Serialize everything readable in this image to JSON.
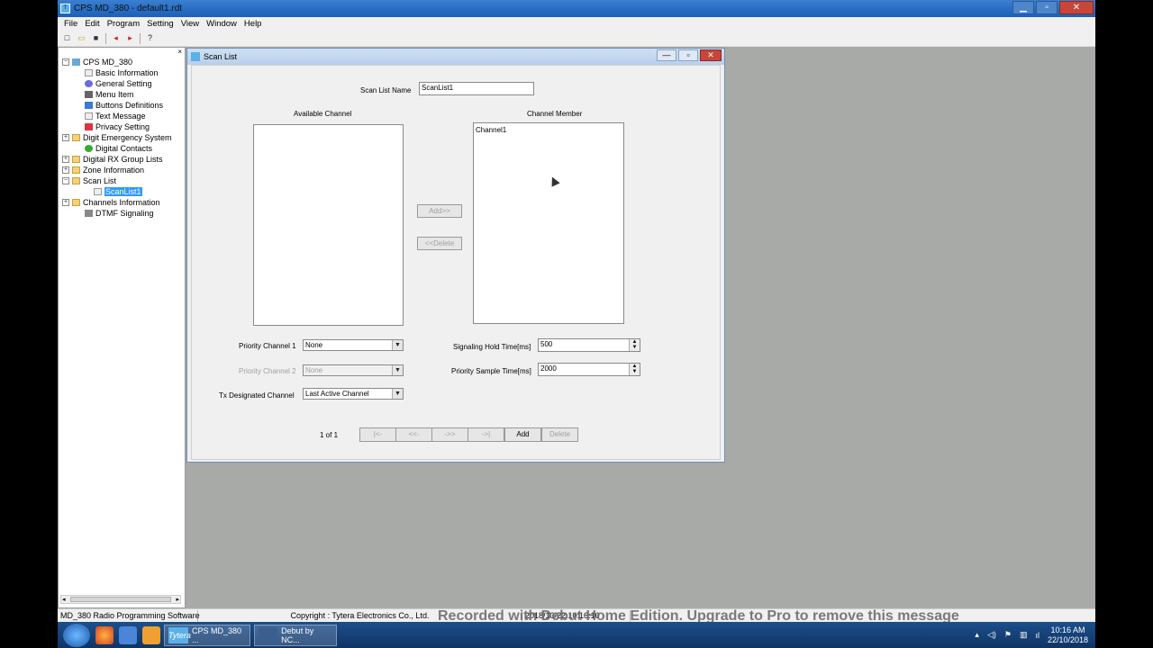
{
  "window": {
    "title": "CPS MD_380 - default1.rdt",
    "icon_text": "T"
  },
  "menu": [
    "File",
    "Edit",
    "Program",
    "Setting",
    "View",
    "Window",
    "Help"
  ],
  "toolbar_icons": [
    "new-icon",
    "open-icon",
    "save-icon",
    "read-icon",
    "write-icon",
    "help-icon"
  ],
  "toolbar_glyphs": {
    "new": "□",
    "open": "▭",
    "save": "■",
    "read": "◂",
    "write": "▸",
    "help": "?"
  },
  "tree": {
    "root": "CPS MD_380",
    "items": [
      "Basic Information",
      "General Setting",
      "Menu Item",
      "Buttons Definitions",
      "Text Message",
      "Privacy Setting",
      "Digit Emergency System",
      "Digital Contacts",
      "Digital RX Group Lists",
      "Zone Information",
      "Scan List",
      "ScanList1",
      "Channels Information",
      "DTMF Signaling"
    ],
    "close_glyph": "×",
    "expand_glyph": "+",
    "collapse_glyph": "−",
    "scroll_left": "◂",
    "scroll_right": "▸"
  },
  "scanlist_window": {
    "title": "Scan List",
    "minimize": "—",
    "maximize": "▫",
    "close": "✕",
    "name_label": "Scan List Name",
    "name_value": "ScanList1",
    "available_label": "Available Channel",
    "member_label": "Channel Member",
    "members": [
      "Channel1"
    ],
    "add_button": "Add>>",
    "delete_button": "<<Delete",
    "priority1_label": "Priority Channel 1",
    "priority1_value": "None",
    "priority2_label": "Priority Channel 2",
    "priority2_value": "None",
    "tx_label": "Tx Designated Channel",
    "tx_value": "Last Active Channel",
    "hold_label": "Signaling Hold Time[ms]",
    "hold_value": "500",
    "sample_label": "Priority Sample Time[ms]",
    "sample_value": "2000",
    "dropdown_glyph": "▼",
    "spin_up": "▲",
    "spin_down": "▼",
    "pager": {
      "count": "1 of 1",
      "first": "|<-",
      "prev": "<<-",
      "next": "->>",
      "last": "->|",
      "add": "Add",
      "delete": "Delete"
    }
  },
  "statusbar": {
    "app": "MD_380 Radio Programming Software",
    "copyright": "Copyright : Tytera Electronics Co., Ltd.",
    "datetime": "2018/10/22 10:16:10"
  },
  "watermark": "Recorded with Debut Home Edition. Upgrade to Pro to remove this message",
  "taskbar": {
    "tasks": [
      {
        "icon": "Tytera",
        "label": "CPS MD_380 ..."
      },
      {
        "icon": "",
        "label": "Debut by NC..."
      }
    ],
    "time": "10:16 AM",
    "date": "22/10/2018",
    "tray_glyphs": {
      "up": "▴",
      "sound": "◁)",
      "flag": "⚑",
      "network": "▥",
      "signal": "ıl"
    }
  },
  "colors": {
    "titlebar": "#2b6fc4",
    "selection": "#3399ff",
    "mdi_background": "#a8aaa8"
  }
}
